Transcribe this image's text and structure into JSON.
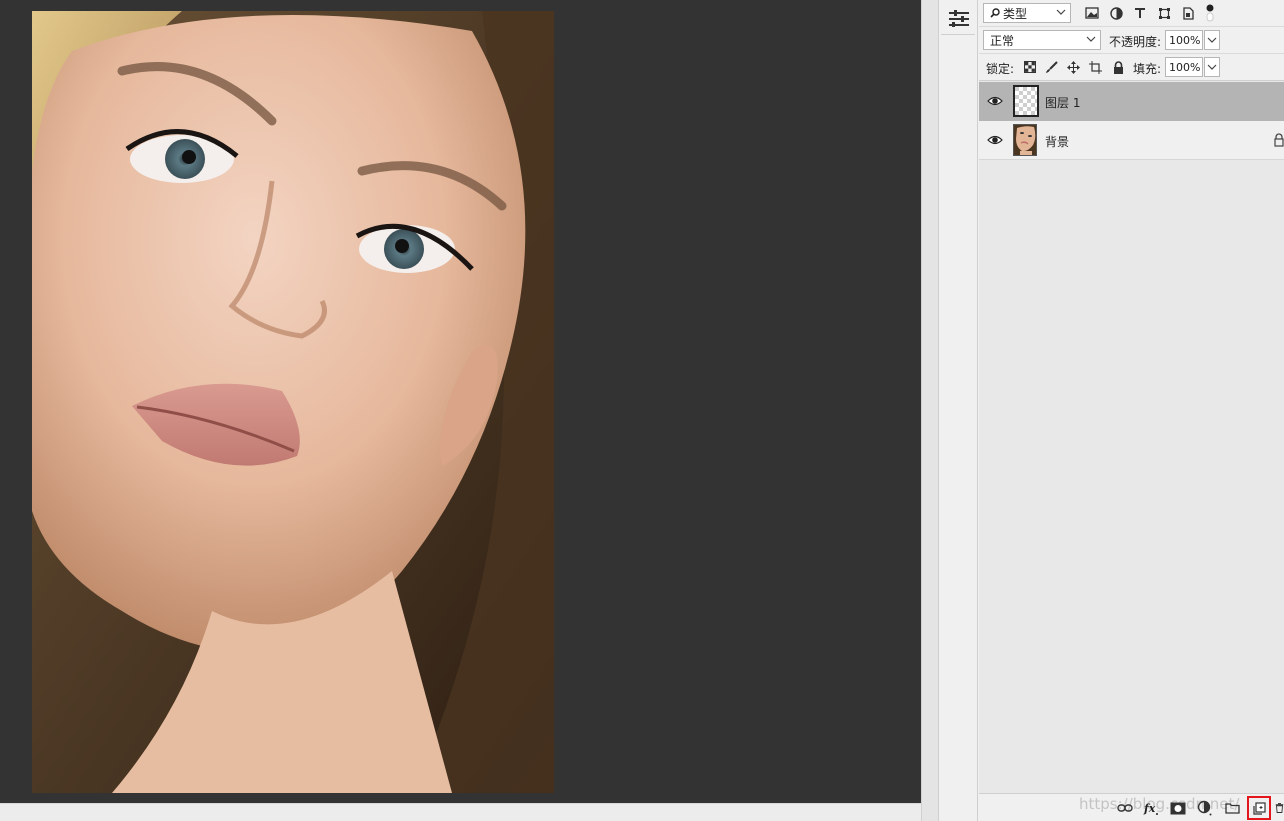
{
  "filter": {
    "kind_label": "类型"
  },
  "blend": {
    "mode_label": "正常",
    "opacity_label": "不透明度:",
    "opacity_value": "100%"
  },
  "lock": {
    "lock_label": "锁定:",
    "fill_label": "填充:",
    "fill_value": "100%"
  },
  "layers": [
    {
      "name": "图层 1",
      "selected": true,
      "visible": true
    },
    {
      "name": "背景",
      "selected": false,
      "visible": true,
      "locked": true
    }
  ],
  "watermark": "https://blog.csdn.net/",
  "colors": {
    "canvas_bg": "#333333",
    "selected_layer": "#b4b4b4",
    "panel_bg": "#e8e8e8",
    "highlight": "#e4161c"
  }
}
